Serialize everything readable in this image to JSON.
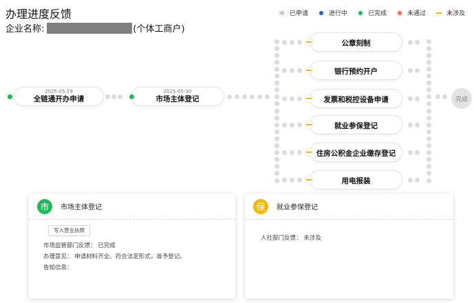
{
  "page": {
    "title": "办理进度反馈",
    "company_label": "企业名称:",
    "company_suffix": "(个体工商户)"
  },
  "legend": [
    {
      "label": "已申请",
      "color": "#c8c8c8",
      "kind": "dot"
    },
    {
      "label": "进行中",
      "color": "#2a5fc9",
      "kind": "dot"
    },
    {
      "label": "已完成",
      "color": "#1fb85a",
      "kind": "dot"
    },
    {
      "label": "未通过",
      "color": "#f06a5a",
      "kind": "dot"
    },
    {
      "label": "未涉及",
      "color": "#f5b800",
      "kind": "line"
    }
  ],
  "flow": {
    "main": [
      {
        "label": "全链通开办申请",
        "date": "2025-05-29",
        "status": "已完成"
      },
      {
        "label": "市场主体登记",
        "date": "2025-05-30",
        "status": "已完成"
      }
    ],
    "branches": [
      {
        "label": "公章刻制",
        "status": "未涉及"
      },
      {
        "label": "银行预约开户",
        "status": "未涉及"
      },
      {
        "label": "发票和税控设备申请",
        "status": "未涉及"
      },
      {
        "label": "就业参保登记",
        "status": "未涉及"
      },
      {
        "label": "住房公积金企业缴存登记",
        "status": "未涉及"
      },
      {
        "label": "用电报装",
        "status": "未涉及"
      }
    ],
    "end_label": "完成"
  },
  "cards": [
    {
      "icon_char": "市",
      "icon_color": "#1fb85a",
      "title": "市场主体登记",
      "button": "写入营业执照",
      "lines": [
        "市场监管部门反馈：  已完成",
        "办理意见：  申请材料齐全、符合法定形式，准予登记。",
        "告知信息："
      ]
    },
    {
      "icon_char": "保",
      "icon_color": "#f5b800",
      "title": "就业参保登记",
      "lines": [
        "人社部门反馈：  未涉及"
      ]
    }
  ]
}
